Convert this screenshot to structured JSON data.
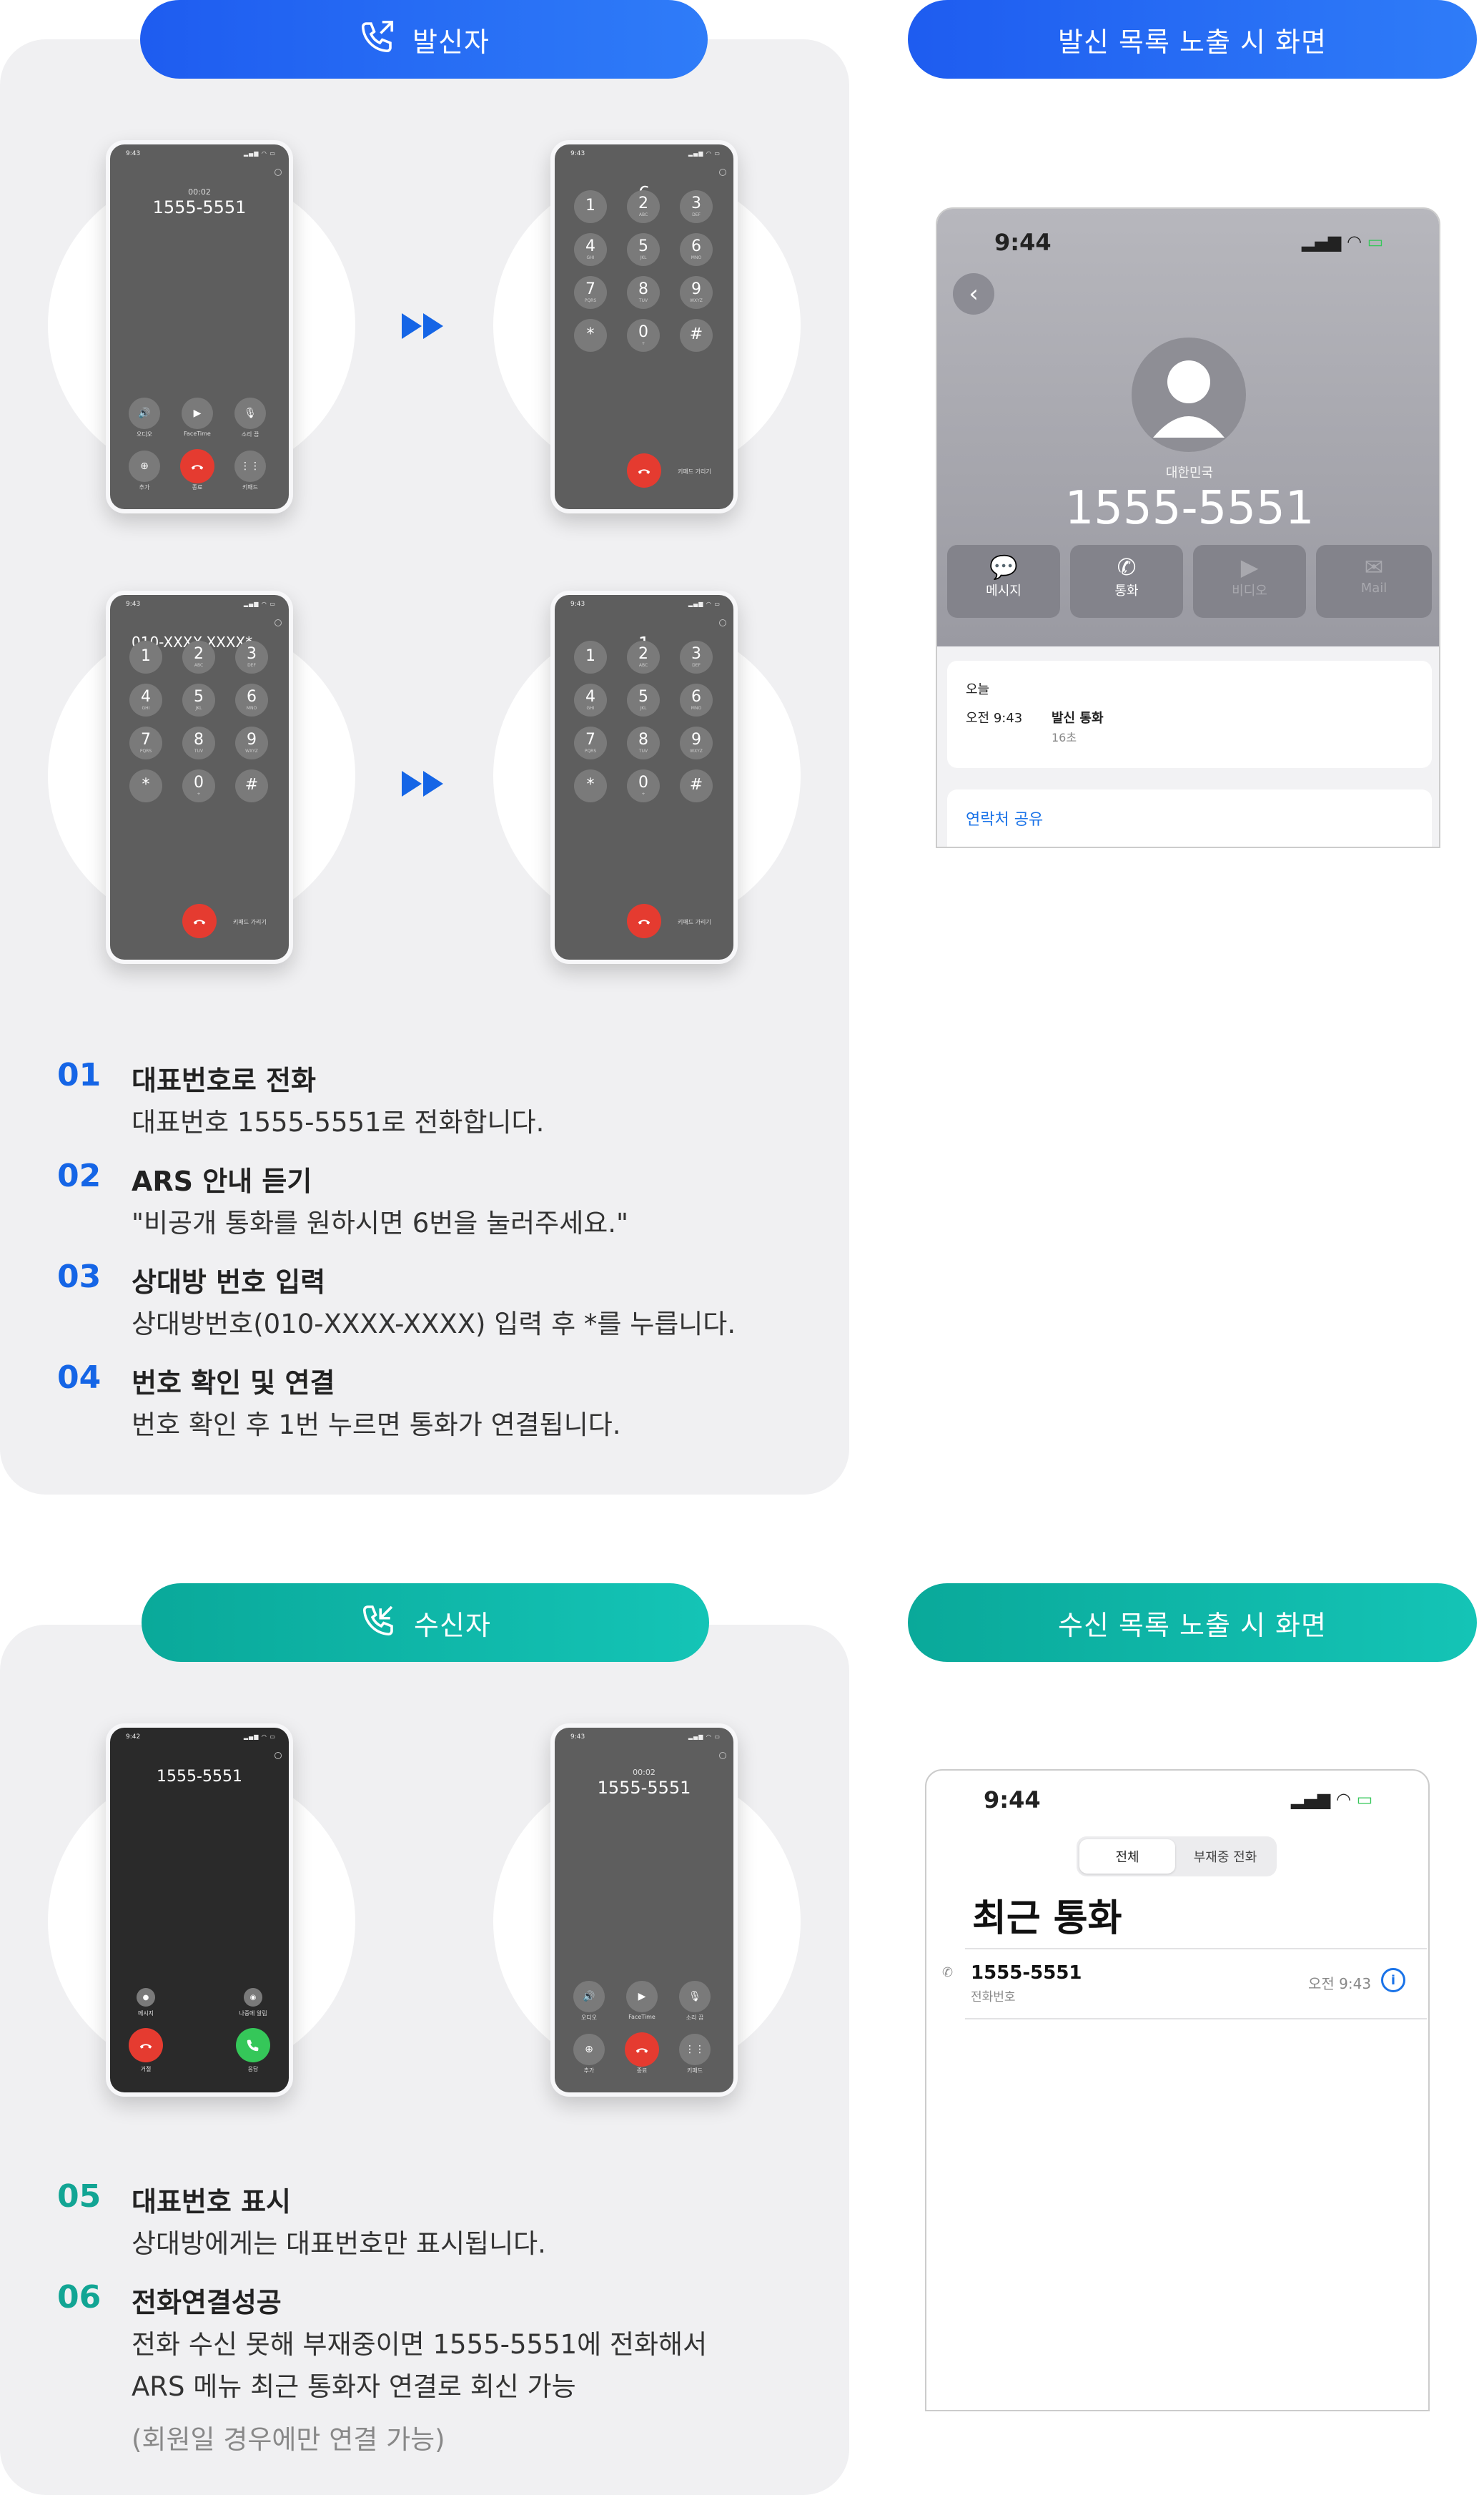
{
  "caller": {
    "pill_label": "발신자",
    "list_pill_label": "발신 목록 노출 시 화면",
    "steps": [
      {
        "no": "01",
        "title": "대표번호로 전화",
        "desc": "대표번호 1555-5551로 전화합니다."
      },
      {
        "no": "02",
        "title": "ARS 안내 듣기",
        "desc": "\"비공개 통화를 원하시면 6번을 눌러주세요.\""
      },
      {
        "no": "03",
        "title": "상대방 번호 입력",
        "desc": "상대방번호(010-XXXX-XXXX) 입력 후 *를 누릅니다."
      },
      {
        "no": "04",
        "title": "번호 확인 및 연결",
        "desc": "번호 확인 후 1번 누르면 통화가 연결됩니다."
      }
    ],
    "phones": {
      "time": "9:43",
      "call_timer": "00:02",
      "call_number": "1555-5551",
      "dial1_digit": "6",
      "dial2_number": "010-XXXX-XXXX*",
      "dial3_digit": "1",
      "hide_keypad": "키패드 가리기",
      "controls": [
        "오디오",
        "FaceTime",
        "소리 끔",
        "추가",
        "종료",
        "키패드"
      ]
    },
    "detail": {
      "time": "9:44",
      "country": "대한민국",
      "number": "1555-5551",
      "actions": [
        "메시지",
        "통화",
        "비디오",
        "Mail"
      ],
      "day": "오늘",
      "entry_time": "오전 9:43",
      "entry_type": "발신 통화",
      "duration": "16초",
      "share": "연락처 공유"
    }
  },
  "receiver": {
    "pill_label": "수신자",
    "list_pill_label": "수신 목록 노출 시 화면",
    "steps": [
      {
        "no": "05",
        "title": "대표번호 표시",
        "desc": "상대방에게는 대표번호만 표시됩니다."
      },
      {
        "no": "06",
        "title": "전화연결성공",
        "desc": "전화 수신 못해 부재중이면 1555-5551에 전화해서",
        "desc2": "ARS 메뉴 최근 통화자 연결로 회신 가능",
        "note": "(회원일 경우에만 연결 가능)"
      }
    ],
    "phones": {
      "incoming_time": "9:42",
      "incoming_number": "1555-5551",
      "incoming_actions": [
        "메시지",
        "나중에 알림",
        "거절",
        "응답"
      ],
      "call_time": "9:43",
      "call_timer": "00:02",
      "call_number": "1555-5551",
      "controls": [
        "오디오",
        "FaceTime",
        "소리 끔",
        "추가",
        "종료",
        "키패드"
      ]
    },
    "recents": {
      "time": "9:44",
      "tab_all": "전체",
      "tab_missed": "부재중 전화",
      "title": "최근 통화",
      "number": "1555-5551",
      "label": "전화번호",
      "entry_time": "오전 9:43"
    }
  },
  "keypad": [
    {
      "d": "1",
      "s": ""
    },
    {
      "d": "2",
      "s": "ABC"
    },
    {
      "d": "3",
      "s": "DEF"
    },
    {
      "d": "4",
      "s": "GHI"
    },
    {
      "d": "5",
      "s": "JKL"
    },
    {
      "d": "6",
      "s": "MNO"
    },
    {
      "d": "7",
      "s": "PQRS"
    },
    {
      "d": "8",
      "s": "TUV"
    },
    {
      "d": "9",
      "s": "WXYZ"
    },
    {
      "d": "*",
      "s": ""
    },
    {
      "d": "0",
      "s": "+"
    },
    {
      "d": "#",
      "s": ""
    }
  ],
  "colors": {
    "blue": "#1e5cf0",
    "teal": "#0fb5a6",
    "end": "#e53b30",
    "answer": "#35c759",
    "panel": "#f0f0f2"
  }
}
